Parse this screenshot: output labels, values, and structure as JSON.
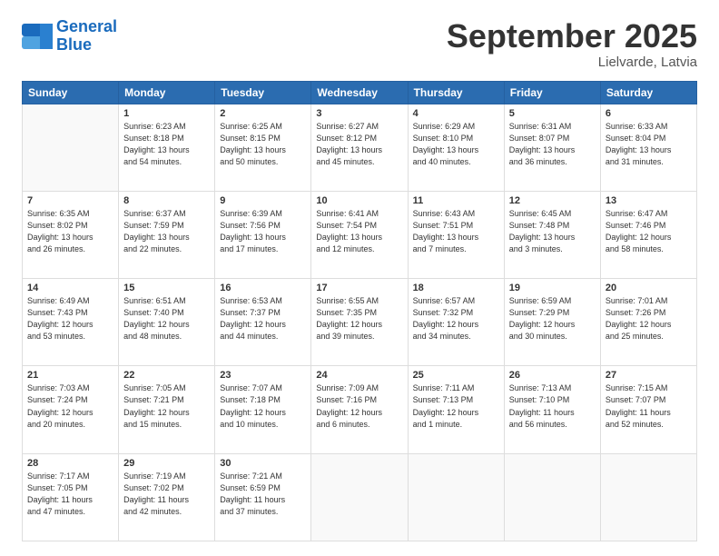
{
  "logo": {
    "line1": "General",
    "line2": "Blue"
  },
  "title": "September 2025",
  "location": "Lielvarde, Latvia",
  "header_days": [
    "Sunday",
    "Monday",
    "Tuesday",
    "Wednesday",
    "Thursday",
    "Friday",
    "Saturday"
  ],
  "weeks": [
    [
      {
        "day": "",
        "info": ""
      },
      {
        "day": "1",
        "info": "Sunrise: 6:23 AM\nSunset: 8:18 PM\nDaylight: 13 hours\nand 54 minutes."
      },
      {
        "day": "2",
        "info": "Sunrise: 6:25 AM\nSunset: 8:15 PM\nDaylight: 13 hours\nand 50 minutes."
      },
      {
        "day": "3",
        "info": "Sunrise: 6:27 AM\nSunset: 8:12 PM\nDaylight: 13 hours\nand 45 minutes."
      },
      {
        "day": "4",
        "info": "Sunrise: 6:29 AM\nSunset: 8:10 PM\nDaylight: 13 hours\nand 40 minutes."
      },
      {
        "day": "5",
        "info": "Sunrise: 6:31 AM\nSunset: 8:07 PM\nDaylight: 13 hours\nand 36 minutes."
      },
      {
        "day": "6",
        "info": "Sunrise: 6:33 AM\nSunset: 8:04 PM\nDaylight: 13 hours\nand 31 minutes."
      }
    ],
    [
      {
        "day": "7",
        "info": "Sunrise: 6:35 AM\nSunset: 8:02 PM\nDaylight: 13 hours\nand 26 minutes."
      },
      {
        "day": "8",
        "info": "Sunrise: 6:37 AM\nSunset: 7:59 PM\nDaylight: 13 hours\nand 22 minutes."
      },
      {
        "day": "9",
        "info": "Sunrise: 6:39 AM\nSunset: 7:56 PM\nDaylight: 13 hours\nand 17 minutes."
      },
      {
        "day": "10",
        "info": "Sunrise: 6:41 AM\nSunset: 7:54 PM\nDaylight: 13 hours\nand 12 minutes."
      },
      {
        "day": "11",
        "info": "Sunrise: 6:43 AM\nSunset: 7:51 PM\nDaylight: 13 hours\nand 7 minutes."
      },
      {
        "day": "12",
        "info": "Sunrise: 6:45 AM\nSunset: 7:48 PM\nDaylight: 13 hours\nand 3 minutes."
      },
      {
        "day": "13",
        "info": "Sunrise: 6:47 AM\nSunset: 7:46 PM\nDaylight: 12 hours\nand 58 minutes."
      }
    ],
    [
      {
        "day": "14",
        "info": "Sunrise: 6:49 AM\nSunset: 7:43 PM\nDaylight: 12 hours\nand 53 minutes."
      },
      {
        "day": "15",
        "info": "Sunrise: 6:51 AM\nSunset: 7:40 PM\nDaylight: 12 hours\nand 48 minutes."
      },
      {
        "day": "16",
        "info": "Sunrise: 6:53 AM\nSunset: 7:37 PM\nDaylight: 12 hours\nand 44 minutes."
      },
      {
        "day": "17",
        "info": "Sunrise: 6:55 AM\nSunset: 7:35 PM\nDaylight: 12 hours\nand 39 minutes."
      },
      {
        "day": "18",
        "info": "Sunrise: 6:57 AM\nSunset: 7:32 PM\nDaylight: 12 hours\nand 34 minutes."
      },
      {
        "day": "19",
        "info": "Sunrise: 6:59 AM\nSunset: 7:29 PM\nDaylight: 12 hours\nand 30 minutes."
      },
      {
        "day": "20",
        "info": "Sunrise: 7:01 AM\nSunset: 7:26 PM\nDaylight: 12 hours\nand 25 minutes."
      }
    ],
    [
      {
        "day": "21",
        "info": "Sunrise: 7:03 AM\nSunset: 7:24 PM\nDaylight: 12 hours\nand 20 minutes."
      },
      {
        "day": "22",
        "info": "Sunrise: 7:05 AM\nSunset: 7:21 PM\nDaylight: 12 hours\nand 15 minutes."
      },
      {
        "day": "23",
        "info": "Sunrise: 7:07 AM\nSunset: 7:18 PM\nDaylight: 12 hours\nand 10 minutes."
      },
      {
        "day": "24",
        "info": "Sunrise: 7:09 AM\nSunset: 7:16 PM\nDaylight: 12 hours\nand 6 minutes."
      },
      {
        "day": "25",
        "info": "Sunrise: 7:11 AM\nSunset: 7:13 PM\nDaylight: 12 hours\nand 1 minute."
      },
      {
        "day": "26",
        "info": "Sunrise: 7:13 AM\nSunset: 7:10 PM\nDaylight: 11 hours\nand 56 minutes."
      },
      {
        "day": "27",
        "info": "Sunrise: 7:15 AM\nSunset: 7:07 PM\nDaylight: 11 hours\nand 52 minutes."
      }
    ],
    [
      {
        "day": "28",
        "info": "Sunrise: 7:17 AM\nSunset: 7:05 PM\nDaylight: 11 hours\nand 47 minutes."
      },
      {
        "day": "29",
        "info": "Sunrise: 7:19 AM\nSunset: 7:02 PM\nDaylight: 11 hours\nand 42 minutes."
      },
      {
        "day": "30",
        "info": "Sunrise: 7:21 AM\nSunset: 6:59 PM\nDaylight: 11 hours\nand 37 minutes."
      },
      {
        "day": "",
        "info": ""
      },
      {
        "day": "",
        "info": ""
      },
      {
        "day": "",
        "info": ""
      },
      {
        "day": "",
        "info": ""
      }
    ]
  ]
}
